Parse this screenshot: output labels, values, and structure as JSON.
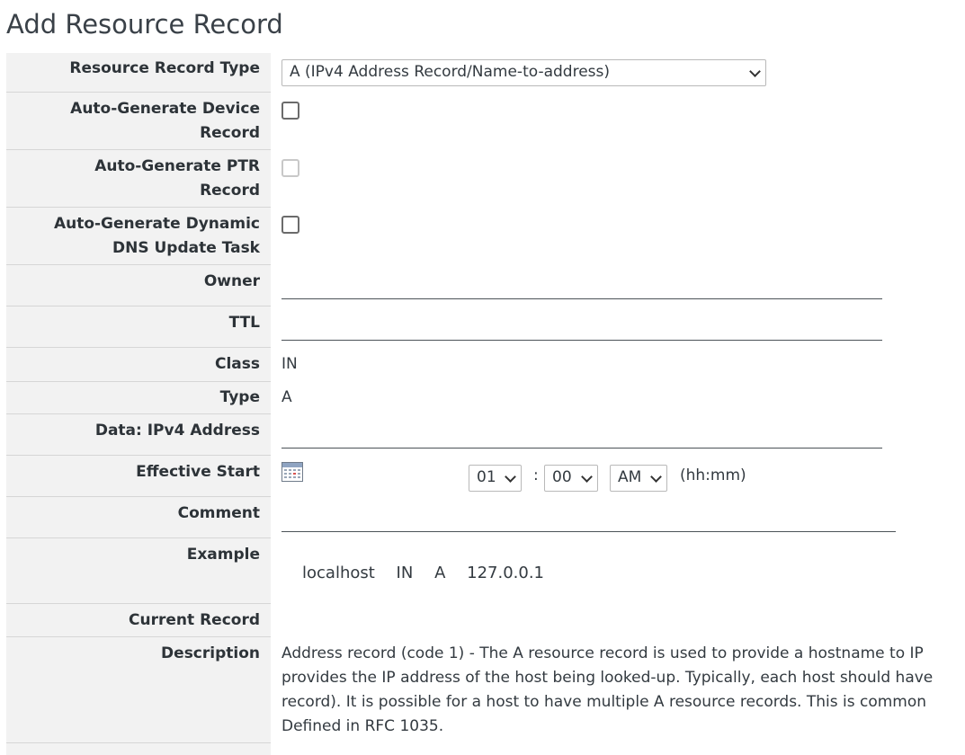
{
  "page": {
    "title": "Add Resource Record"
  },
  "form": {
    "rr_type": {
      "label": "Resource Record Type",
      "selected": "A (IPv4 Address Record/Name-to-address)"
    },
    "auto_device": {
      "label_line1": "Auto-Generate Device",
      "label_line2": "Record",
      "checked": false
    },
    "auto_ptr": {
      "label_line1": "Auto-Generate PTR",
      "label_line2": "Record",
      "checked": false,
      "disabled": true
    },
    "auto_ddns": {
      "label_line1": "Auto-Generate Dynamic",
      "label_line2": "DNS Update Task",
      "checked": false
    },
    "owner": {
      "label": "Owner",
      "value": ""
    },
    "ttl": {
      "label": "TTL",
      "value": ""
    },
    "class": {
      "label": "Class",
      "value": "IN"
    },
    "type": {
      "label": "Type",
      "value": "A"
    },
    "ipv4": {
      "label": "Data: IPv4 Address",
      "value": ""
    },
    "effective_start": {
      "label": "Effective Start",
      "hour": "01",
      "separator": ":",
      "minute": "00",
      "ampm": "AM",
      "format_hint": "(hh:mm)"
    },
    "comment": {
      "label": "Comment",
      "value": ""
    },
    "example": {
      "label": "Example",
      "host": "localhost",
      "class": "IN",
      "type": "A",
      "address": "127.0.0.1"
    },
    "current_record": {
      "label": "Current Record",
      "value": ""
    },
    "description": {
      "label": "Description",
      "lines": [
        "Address record (code 1) - The A resource record is used to provide a hostname to IP",
        "provides the IP address of the host being looked-up. Typically, each host should have",
        "record). It is possible for a host to have multiple A resource records. This is common",
        "Defined in RFC 1035."
      ]
    }
  },
  "icons": {
    "calendar": "calendar-icon",
    "dropdown": "chevron-down-icon"
  },
  "colors": {
    "label_background": "#f2f2f2",
    "calendar_accent": "#d9534f"
  }
}
